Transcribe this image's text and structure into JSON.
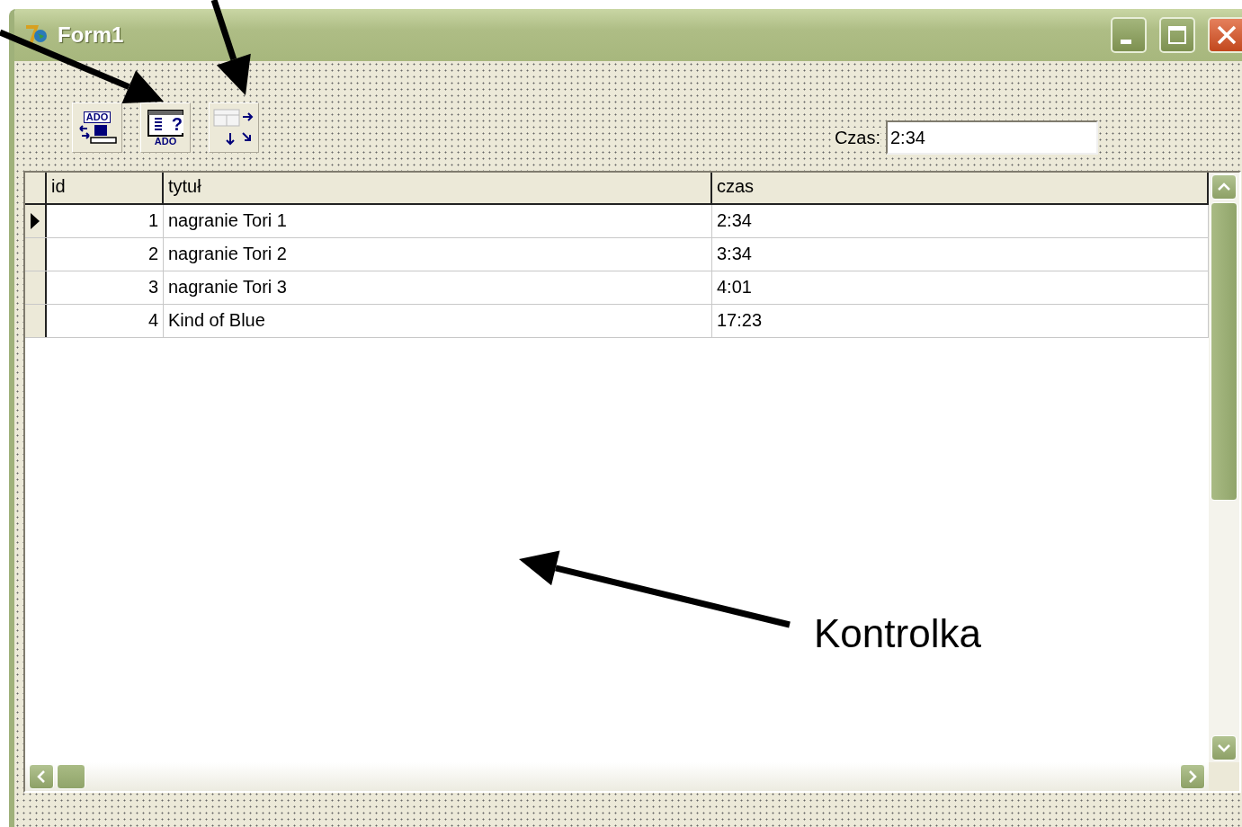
{
  "window": {
    "title": "Form1"
  },
  "components": [
    {
      "kind": "connection",
      "label": "ADO"
    },
    {
      "kind": "query",
      "label": "ADO",
      "mark": "?"
    },
    {
      "kind": "datasource"
    }
  ],
  "czas_field": {
    "label": "Czas:",
    "value": "2:34"
  },
  "grid": {
    "columns": [
      "id",
      "tytuł",
      "czas"
    ],
    "rows": [
      {
        "id": "1",
        "title": "nagranie Tori 1",
        "time": "2:34",
        "selected": true
      },
      {
        "id": "2",
        "title": "nagranie Tori 2",
        "time": "3:34",
        "selected": false
      },
      {
        "id": "3",
        "title": "nagranie Tori 3",
        "time": "4:01",
        "selected": false
      },
      {
        "id": "4",
        "title": "Kind of Blue",
        "time": "17:23",
        "selected": false
      }
    ]
  },
  "annotation": {
    "label": "Kontrolka"
  }
}
